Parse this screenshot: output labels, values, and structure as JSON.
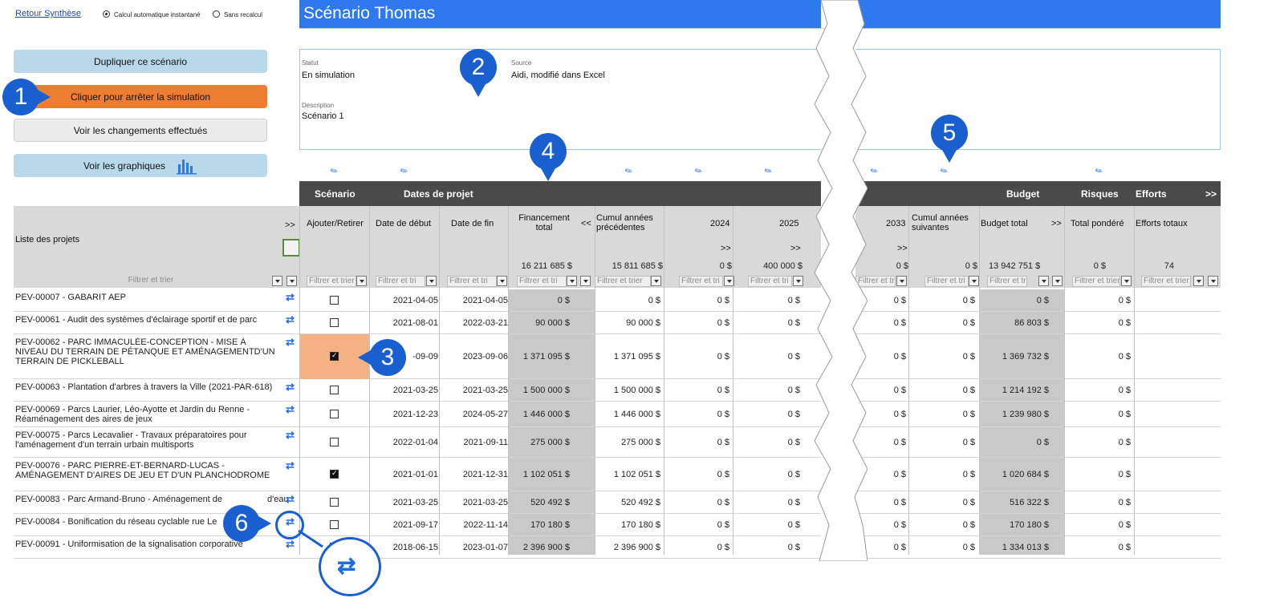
{
  "top": {
    "back_link": "Retour Synthèse",
    "radio_auto": "Calcul automatique instantané",
    "radio_none": "Sans recalcul"
  },
  "buttons": {
    "duplicate": "Dupliquer ce scénario",
    "stop_sim": "Cliquer pour arrêter la simulation",
    "changes": "Voir les changements effectués",
    "charts": "Voir les graphiques"
  },
  "title": "Scénario Thomas",
  "info": {
    "status_label": "Statut",
    "status_value": "En simulation",
    "source_label": "Source",
    "source_value": "Aidi, modifié dans Excel",
    "desc_label": "Description",
    "desc_value": "Scénario 1"
  },
  "sections": {
    "scenario": "Scénario",
    "dates": "Dates de projet",
    "budget": "Budget",
    "risks": "Risques",
    "efforts": "Efforts",
    "more": ">>"
  },
  "headers": {
    "projects": "Liste des projets",
    "add_remove": "Ajouter/Retirer",
    "start": "Date de début",
    "end": "Date de fin",
    "funding": "Financement total",
    "prev": "Cumul années précédentes",
    "y2024": "2024",
    "y2025": "2025",
    "y2033": "2033",
    "next": "Cumul années suivantes",
    "budget_total": "Budget total",
    "risk_total": "Total pondéré",
    "effort_total": "Efforts totaux",
    "collapse": "<<",
    "expand": ">>"
  },
  "totals": {
    "funding": "16 211 685 $",
    "prev": "15 811 685 $",
    "y2024": "0 $",
    "y2025": "400 000 $",
    "y2033": "0 $",
    "next": "0 $",
    "budget": "13 942 751 $",
    "risk": "0 $",
    "effort": "74"
  },
  "filter": {
    "long": "Filtrer et trier",
    "short": "Filtrer et tri"
  },
  "rows": [
    {
      "name": "PEV-00007 - GABARIT AEP",
      "checked": false,
      "start": "2021-04-05",
      "end": "2021-04-05",
      "funding": "0 $",
      "prev": "0 $",
      "y2024": "0 $",
      "y2025": "0 $",
      "y2033": "0 $",
      "next": "0 $",
      "budget": "0 $",
      "risk": "0 $"
    },
    {
      "name": "PEV-00061 - Audit des systèmes d'éclairage sportif et de parc",
      "checked": false,
      "start": "2021-08-01",
      "end": "2022-03-21",
      "funding": "90 000 $",
      "prev": "90 000 $",
      "y2024": "0 $",
      "y2025": "0 $",
      "y2033": "0 $",
      "next": "0 $",
      "budget": "86 803 $",
      "risk": "0 $"
    },
    {
      "name": "PEV-00062 - PARC IMMACULÉE-CONCEPTION - MISE À NIVEAU DU TERRAIN DE PÉTANQUE ET AMÉNAGEMENTD'UN TERRAIN DE PICKLEBALL",
      "checked": true,
      "start": "2021-09-09",
      "start_shown": "-09-09",
      "end": "2023-09-06",
      "funding": "1 371 095 $",
      "prev": "1 371 095 $",
      "y2024": "0 $",
      "y2025": "0 $",
      "y2033": "0 $",
      "next": "0 $",
      "budget": "1 369 732 $",
      "risk": "0 $"
    },
    {
      "name": "PEV-00063 - Plantation d'arbres à travers la Ville (2021-PAR-618)",
      "checked": false,
      "start": "2021-03-25",
      "end": "2021-03-25",
      "funding": "1 500 000 $",
      "prev": "1 500 000 $",
      "y2024": "0 $",
      "y2025": "0 $",
      "y2033": "0 $",
      "next": "0 $",
      "budget": "1 214 192 $",
      "risk": "0 $"
    },
    {
      "name": "PEV-00069 - Parcs Laurier, Léo-Ayotte et Jardin du Renne - Réaménagement des aires de jeux",
      "checked": false,
      "start": "2021-12-23",
      "end": "2024-05-27",
      "funding": "1 446 000 $",
      "prev": "1 446 000 $",
      "y2024": "0 $",
      "y2025": "0 $",
      "y2033": "0 $",
      "next": "0 $",
      "budget": "1 239 980 $",
      "risk": "0 $"
    },
    {
      "name": "PEV-00075 - Parcs Lecavalier - Travaux préparatoires pour l'aménagement d'un terrain urbain multisports",
      "checked": false,
      "start": "2022-01-04",
      "end": "2021-09-11",
      "funding": "275 000 $",
      "prev": "275 000 $",
      "y2024": "0 $",
      "y2025": "0 $",
      "y2033": "0 $",
      "next": "0 $",
      "budget": "0 $",
      "risk": "0 $"
    },
    {
      "name": "PEV-00076 - PARC PIERRE-ET-BERNARD-LUCAS - AMÉNAGEMENT D'AIRES DE JEU ET D'UN PLANCHODROME",
      "checked": true,
      "start": "2021-01-01",
      "end": "2021-12-31",
      "funding": "1 102 051 $",
      "prev": "1 102 051 $",
      "y2024": "0 $",
      "y2025": "0 $",
      "y2033": "0 $",
      "next": "0 $",
      "budget": "1 020 684 $",
      "risk": "0 $"
    },
    {
      "name": "PEV-00083 - Parc Armand-Bruno - Aménagement de",
      "name_tail": "d'eau",
      "checked": false,
      "start": "2021-03-25",
      "end": "2021-03-25",
      "funding": "520 492 $",
      "prev": "520 492 $",
      "y2024": "0 $",
      "y2025": "0 $",
      "y2033": "0 $",
      "next": "0 $",
      "budget": "516 322 $",
      "risk": "0 $"
    },
    {
      "name": "PEV-00084 - Bonification du réseau cyclable rue Le",
      "checked": false,
      "start": "2021-09-17",
      "end": "2022-11-14",
      "funding": "170 180 $",
      "prev": "170 180 $",
      "y2024": "0 $",
      "y2025": "0 $",
      "y2033": "0 $",
      "next": "0 $",
      "budget": "170 180 $",
      "risk": "0 $"
    },
    {
      "name": "PEV-00091 - Uniformisation de la signalisation corporative",
      "checked": false,
      "start": "2018-06-15",
      "end": "2023-01-07",
      "funding": "2 396 900 $",
      "prev": "2 396 900 $",
      "y2024": "0 $",
      "y2025": "0 $",
      "y2033": "0 $",
      "next": "0 $",
      "budget": "1 334 013 $",
      "risk": "0 $"
    }
  ],
  "callouts": [
    "1",
    "2",
    "3",
    "4",
    "5",
    "6"
  ],
  "colors": {
    "accent": "#2e79ee",
    "callout": "#1a5fd0",
    "orange": "#ed7d31",
    "highlight": "#f4b183"
  }
}
